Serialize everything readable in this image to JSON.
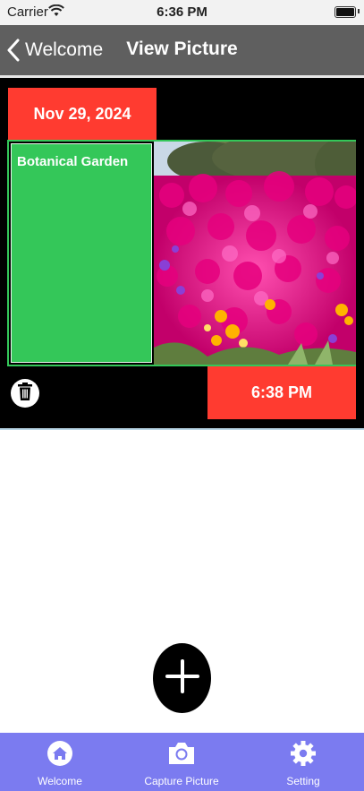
{
  "status_bar": {
    "carrier": "Carrier",
    "time": "6:36 PM"
  },
  "nav": {
    "back_label": "Welcome",
    "title": "View Picture"
  },
  "entry": {
    "date": "Nov 29, 2024",
    "label": "Botanical Garden",
    "time": "6:38 PM"
  },
  "tabs": [
    {
      "label": "Welcome",
      "icon": "home-icon"
    },
    {
      "label": "Capture Picture",
      "icon": "camera-icon"
    },
    {
      "label": "Setting",
      "icon": "gear-icon"
    }
  ],
  "colors": {
    "nav_bg": "#5f5f5f",
    "accent_red": "#ff3b30",
    "accent_green": "#34c759",
    "tab_bar": "#7b7bf0"
  }
}
